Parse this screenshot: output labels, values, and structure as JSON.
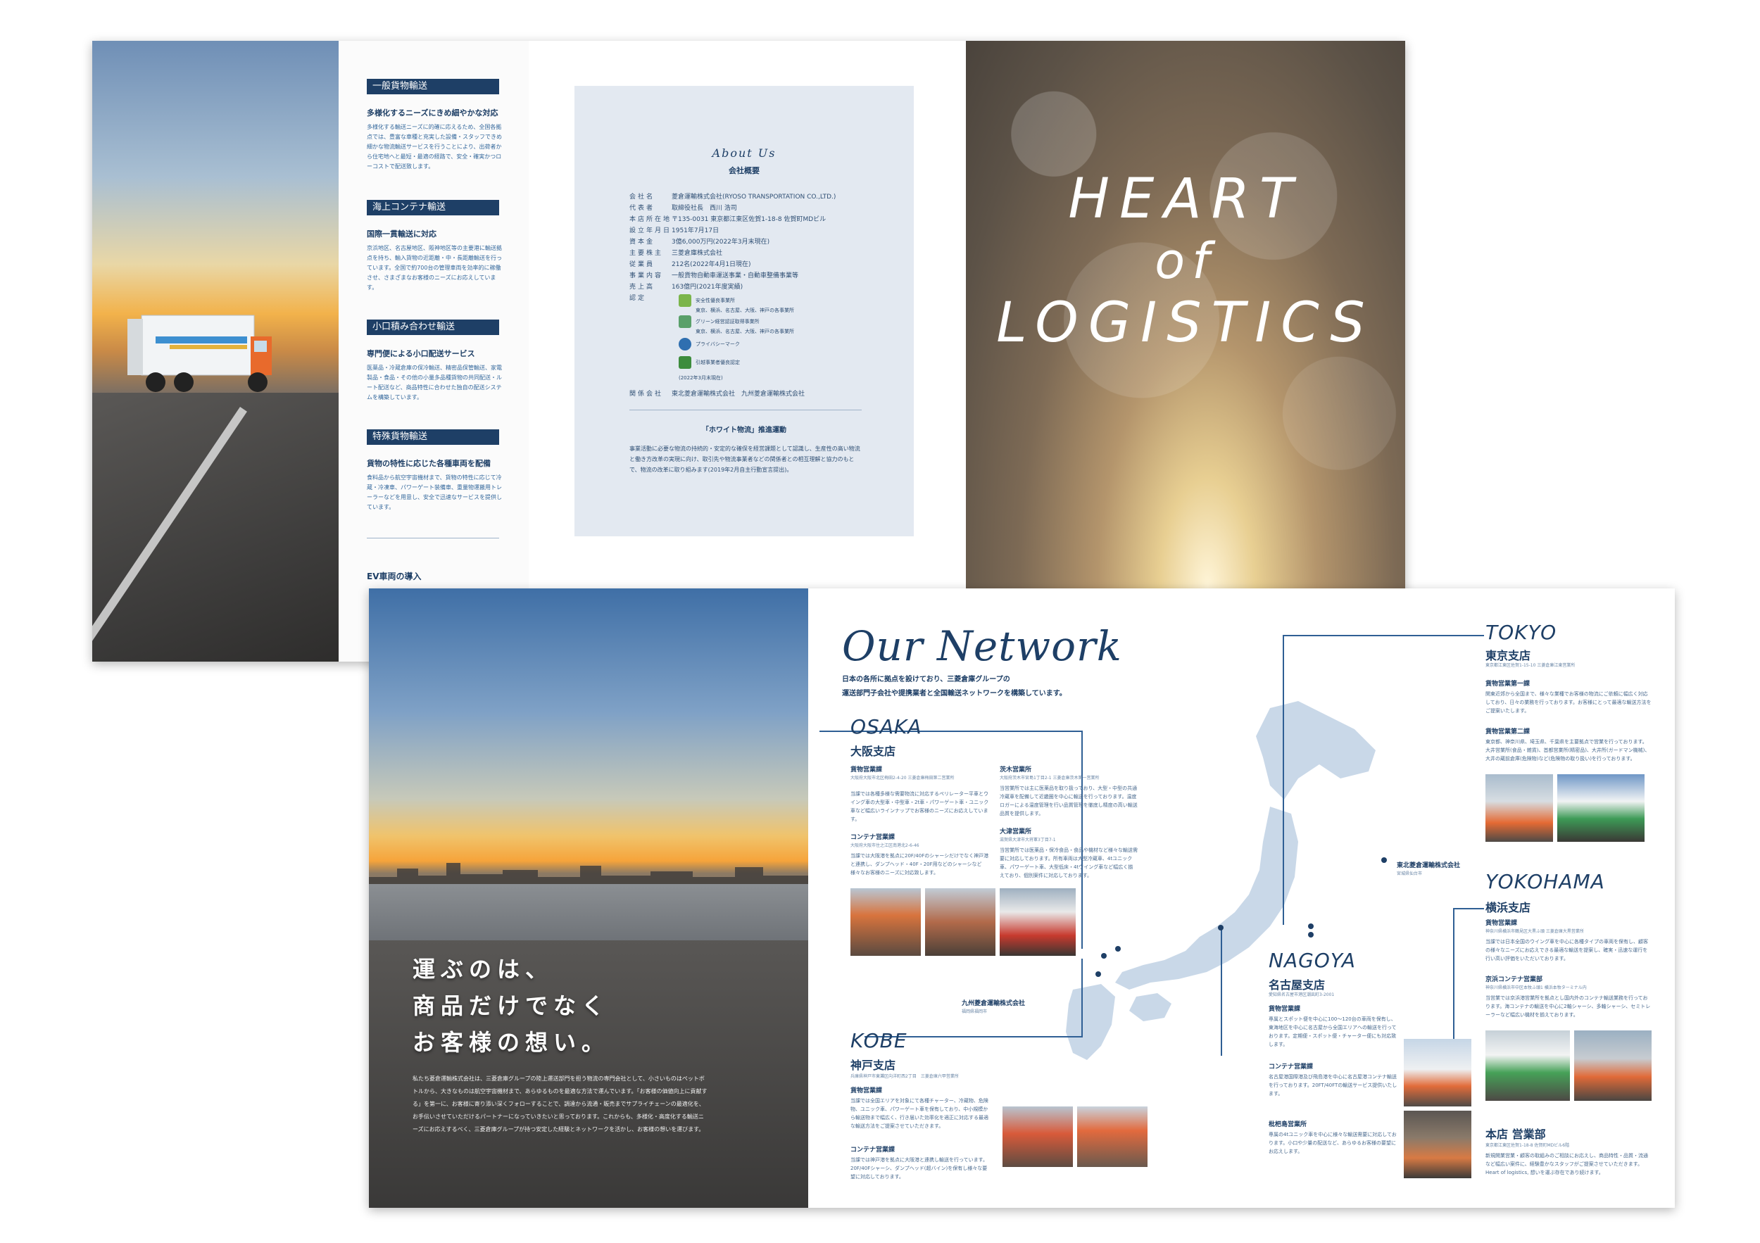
{
  "services": [
    {
      "heading": "一般貨物輸送",
      "subtitle": "多様化するニーズにきめ細やかな対応",
      "body": "多様化する輸送ニーズに的確に応えるため、全国各拠点では、豊富な車種と充実した設備・スタッフできめ細かな物流輸送サービスを行うことにより、出荷者から住宅地へと最短・最適の経路で、安全・確実かつローコストで配送致します。"
    },
    {
      "heading": "海上コンテナ輸送",
      "subtitle": "国際一貫輸送に対応",
      "body": "京浜地区、名古屋地区、阪神地区等の主要港に輸送拠点を持ち、輸入貨物の近距離・中・長距離輸送を行っています。全国で約700台の管理車両を効率的に稼働させ、さまざまなお客様のニーズにお応えしています。"
    },
    {
      "heading": "小口積み合わせ輸送",
      "subtitle": "専門便による小口配送サービス",
      "body": "医薬品・冷蔵倉庫の保冷輸送、精密品保管輸送、家電製品・食品・その他の小量多品種貨物の共同配送・ルート配送など、商品特性に合わせた独自の配送システムを構築しています。"
    },
    {
      "heading": "特殊貨物輸送",
      "subtitle": "貨物の特性に応じた各種車両を配備",
      "body": "食料品から航空宇宙機材まで、貨物の特性に応じて冷蔵・冷凍車、パワーゲート装備車、重量物運搬用トレーラーなどを用意し、安全で迅速なサービスを提供しています。"
    },
    {
      "heading": "EV車両の導入",
      "subtitle": "",
      "body": ""
    }
  ],
  "about": {
    "title": "About Us",
    "subtitle": "会社概要",
    "profile": [
      {
        "key": "会社名",
        "value": "菱倉運輸株式会社(RYOSO TRANSPORTATION CO.,LTD.)"
      },
      {
        "key": "代表者",
        "value": "取締役社長　西川 浩司"
      },
      {
        "key": "本店所在地",
        "value": "〒135-0031 東京都江東区佐賀1-18-8 佐賀町MDビル"
      },
      {
        "key": "設立年月日",
        "value": "1951年7月17日"
      },
      {
        "key": "資本金",
        "value": "3億6,000万円(2022年3月末現在)"
      },
      {
        "key": "主要株主",
        "value": "三菱倉庫株式会社"
      },
      {
        "key": "従業員",
        "value": "212名(2022年4月1日現在)"
      },
      {
        "key": "事業内容",
        "value": "一般貨物自動車運送事業・自動車整備事業等"
      },
      {
        "key": "売上高",
        "value": "163億円(2021年度実績)"
      },
      {
        "key": "認定",
        "value": ""
      }
    ],
    "certs": [
      {
        "name": "安全性優良事業所",
        "note": "東京、横浜、名古屋、大阪、神戸の各事業所",
        "color": "#7bb54b"
      },
      {
        "name": "グリーン経営認証取得事業所",
        "note": "東京、横浜、名古屋、大阪、神戸の各事業所",
        "color": "#5aa06a"
      },
      {
        "name": "プライバシーマーク",
        "note": "",
        "color": "#2f6fb0"
      },
      {
        "name": "引越事業者優良認定",
        "note": "",
        "color": "#3d8c3d"
      }
    ],
    "cert_date": "(2022年3月末現在)",
    "affiliates_key": "関係会社",
    "affiliates": "東北菱倉運輸株式会社　九州菱倉運輸株式会社",
    "white_logistics_title": "「ホワイト物流」推進運動",
    "white_logistics_body": "事業活動に必要な物流の持続的・安定的な確保を経営課題として認識し、生産性の高い物流と働き方改革の実現に向け、取引先や物流事業者などの関係者との相互理解と協力のもとで、物流の改革に取り組みます(2019年2月自主行動宣言提出)。"
  },
  "cover": {
    "line1": "HEART",
    "line2": "of",
    "line3": "LOGISTICS"
  },
  "catchcopy": {
    "line1": "運ぶのは、",
    "line2": "商品だけでなく",
    "line3": "お客様の想い。",
    "body": "私たち菱倉運輸株式会社は、三菱倉庫グループの陸上運送部門を担う物流の専門会社として、小さいものはペットボトルから、大きなものは航空宇宙機材まで、あらゆるものを最適な方法で運んでいます。「お客様の価値向上に貢献する」を第一に、お客様に寄り添い深くフォローすることで、調達から流通・販売までサプライチェーンの最適化を、お手伝いさせていただけるパートナーになっていきたいと思っております。これからも、多様化・高度化する輸送ニーズにお応えするべく、三菱倉庫グループが持つ安定した経験とネットワークを活かし、お客様の想いを運びます。"
  },
  "network": {
    "title": "Our Network",
    "intro_line1": "日本の各所に拠点を設けており、三菱倉庫グループの",
    "intro_line2": "運送部門子会社や提携業者と全国輸送ネットワークを構築しています。",
    "osaka": {
      "city": "OSAKA",
      "branch": "大阪支店",
      "depts": [
        {
          "name": "貨物営業課",
          "addr": "大阪府大阪市北区梅田2-4-20 三菱倉庫梅田第二営業所",
          "text": "当課では各種多様な需要物流に対応するペリレーター平車とウイング車の大型車・中型車・2t車・パワーゲート車・ユニック車など幅広いラインナップでお客様のニーズにお応えしています。"
        },
        {
          "name": "コンテナ営業課",
          "addr": "大阪府大阪市住之江区南港北2-6-46",
          "text": "当課では大阪港を拠点に20F/40Fのシャーシだけでなく神戸港と連携し、ダンプヘッド・40F・20F用などのシャーシなど様々なお客様のニーズに対応致します。"
        },
        {
          "name": "茨木営業所",
          "addr": "大阪府茨木市宮島1丁目2-1 三菱倉庫茨木第一営業所",
          "text": "当営業所では主に医薬品を取り扱っており、大型・中型の共通冷蔵車を配備して近畿圏を中心に輸送を行っております。温度ロガーによる温度管理を行い品質管理を徹底し精度の高い輸送品質を提供します。"
        },
        {
          "name": "大津営業所",
          "addr": "滋賀県大津市大将軍3丁目7-1",
          "text": "当営業所では医薬品・保冷食品・食品や機材など様々な輸送需要に対応しております。所有車両は大型冷蔵車、4tユニック車、パワーゲート車、大型低床・4tウイング車など幅広く揃えており、個別案件に対応しております。"
        }
      ]
    },
    "kobe": {
      "city": "KOBE",
      "branch": "神戸支店",
      "addr": "兵庫県神戸市東灘区向洋町西2丁目　三菱倉庫六甲営業所",
      "depts": [
        {
          "name": "貨物営業課",
          "text": "当課では全国エリアを対象にて各種チャーター、冷蔵物、危険物、ユニック車、パワーゲート車を保有しており、中小規模から輸送物まで幅広く、行き届いた効率化を適正に対応する最適な輸送方法をご提案させていただきます。"
        },
        {
          "name": "コンテナ営業課",
          "text": "当課では神戸港を拠点に大阪港と連携し輸送を行っています。20F/40Fシャーシ、ダンプヘッド(超バイン)を保有し様々な要望に対応しております。"
        }
      ]
    },
    "tokyo": {
      "city": "TOKYO",
      "branch": "東京支店",
      "addr": "東京都江東区佐賀1-15-10 三菱倉庫江東営業所",
      "depts": [
        {
          "name": "貨物営業第一課",
          "text": "関東近郊から全国まで、様々な業種でお客様の物流にご依頼に幅広く対応しており、日々の業務を行っております。お客様にとって最適な輸送方法をご提案いたします。"
        },
        {
          "name": "貨物営業第二課",
          "text": "東京都、神奈川県、埼玉県、千葉県を主要拠点で営業を行っております。大井営業所(食品・雑貨)、首都営業所(精密品)、大井所(ガードマン機械)、大井の蔵前倉庫(危険物)など(危険物の取り扱い)を行っております。"
        }
      ]
    },
    "yokohama": {
      "city": "YOKOHAMA",
      "branch": "横浜支店",
      "depts": [
        {
          "name": "貨物営業課",
          "addr": "神奈川県横浜市鶴見区大黒ふ頭 三菱倉庫大黒営業所",
          "text": "当課では日本全国のウイング車を中心に各種タイプの車両を保有し、顧客の様々なニーズにお応えできる最適な輸送を提案し、確実・迅速な運行を行い高い評価をいただいております。"
        },
        {
          "name": "京浜コンテナ営業部",
          "addr": "神奈川県横浜市中区本牧ふ頭1 横浜本牧ターミナル内",
          "text": "当営業では京浜港営業所を拠点とし国内外のコンテナ輸送業務を行っております。海コンテナの輸送を中心に2軸シャーシ、多軸シャーシ、セミトレーラーなど幅広い機材を揃えております。"
        }
      ]
    },
    "nagoya": {
      "city": "NAGOYA",
      "branch": "名古屋支店",
      "addr": "愛知県名古屋市港区潮凪町3-2001",
      "depts": [
        {
          "name": "貨物営業課",
          "text": "専属とスポット便を中心に100〜120台の車両を保有し、東海地区を中心に名古屋から全国エリアへの輸送を行っております。定期便・スポット便・チャーター便にも対応致します。"
        },
        {
          "name": "コンテナ営業課",
          "text": "名古屋港国際港及び飛島港を中心に名古屋港コンテナ輸送を行っております。20FT/40FTの輸送サービス提供いたします。"
        },
        {
          "name": "枇杷島営業所",
          "text": "専属の4tユニック車を中心に様々な輸送需要に対応しております。小口や少量の配送など、あらゆるお客様の要望にお応えします。"
        }
      ]
    },
    "honten": {
      "branch": "本店 営業部",
      "addr": "東京都江東区佐賀1-18-8 佐賀町MDビル6階",
      "text": "新規開業営業・顧客の取組みのご相談にお応えし、商品特性・品質・流通など幅広い案件に、経験豊かなスタッフがご提案させていただきます。Heart of logistics, 想いを運ぶ存在であり続けます。"
    },
    "tohoku": {
      "name": "東北菱倉運輸株式会社",
      "addr": "宮城県仙台市"
    },
    "kyushu": {
      "name": "九州菱倉運輸株式会社",
      "addr": "福岡県福岡市"
    }
  },
  "colors": {
    "navy": "#1e3f66",
    "map": "#c9d8e8",
    "panel": "#e3e9f1"
  }
}
